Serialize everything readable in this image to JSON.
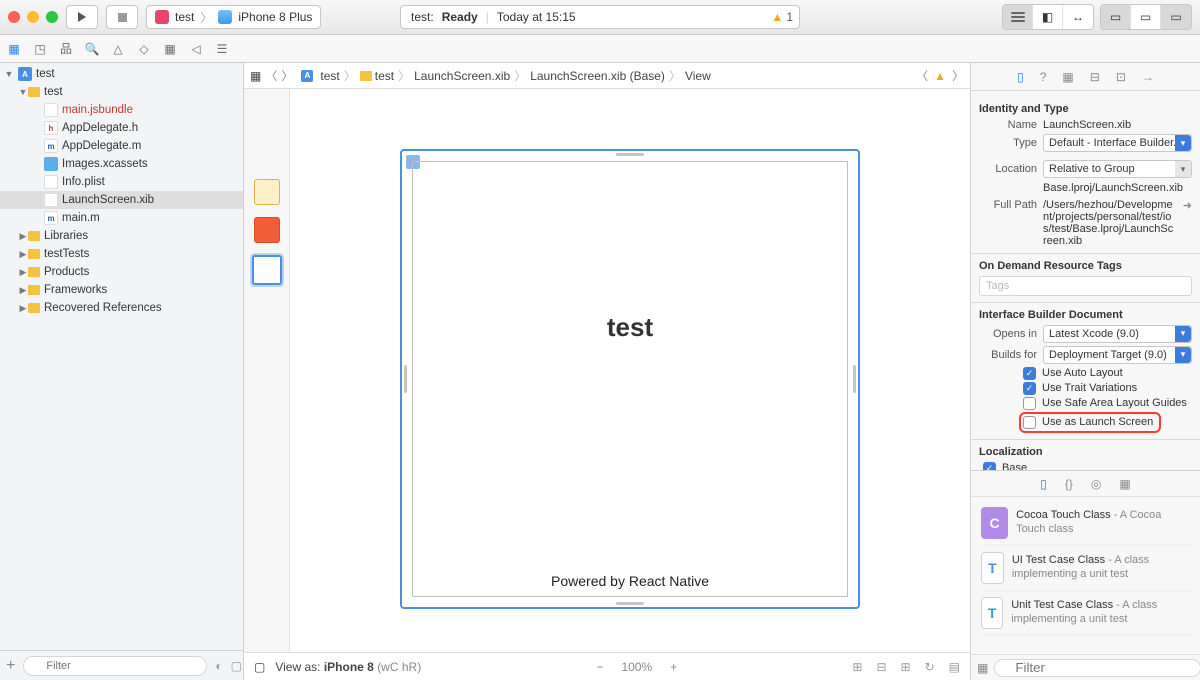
{
  "titlebar": {
    "scheme_target": "test",
    "scheme_device": "iPhone 8 Plus",
    "status_project": "test:",
    "status_state": "Ready",
    "status_time": "Today at 15:15",
    "warning_count": "1"
  },
  "navigator": {
    "root": "test",
    "group": "test",
    "files": {
      "main_jsbundle": "main.jsbundle",
      "appdelegate_h": "AppDelegate.h",
      "appdelegate_m": "AppDelegate.m",
      "images_xcassets": "Images.xcassets",
      "info_plist": "Info.plist",
      "launchscreen_xib": "LaunchScreen.xib",
      "main_m": "main.m"
    },
    "folders": {
      "libraries": "Libraries",
      "testTests": "testTests",
      "products": "Products",
      "frameworks": "Frameworks",
      "recovered": "Recovered References"
    },
    "filter_placeholder": "Filter",
    "add_label": "+"
  },
  "jumpbar": {
    "items": [
      "test",
      "test",
      "LaunchScreen.xib",
      "LaunchScreen.xib (Base)",
      "View"
    ]
  },
  "canvas": {
    "title": "test",
    "subtitle": "Powered by React Native",
    "view_as_prefix": "View as:",
    "view_as_device": "iPhone 8",
    "view_as_suffix": "(wC hR)",
    "zoom_level": "100%"
  },
  "inspector": {
    "section_identity": "Identity and Type",
    "name_label": "Name",
    "name_value": "LaunchScreen.xib",
    "type_label": "Type",
    "type_value": "Default - Interface Builder...",
    "location_label": "Location",
    "location_value": "Relative to Group",
    "location_path": "Base.lproj/LaunchScreen.xib",
    "fullpath_label": "Full Path",
    "fullpath_value": "/Users/hezhou/Development/projects/personal/test/ios/test/Base.lproj/LaunchScreen.xib",
    "section_ondemand": "On Demand Resource Tags",
    "tags_placeholder": "Tags",
    "section_ibdoc": "Interface Builder Document",
    "opensin_label": "Opens in",
    "opensin_value": "Latest Xcode (9.0)",
    "buildsfor_label": "Builds for",
    "buildsfor_value": "Deployment Target (9.0)",
    "chk_autolayout": "Use Auto Layout",
    "chk_trait": "Use Trait Variations",
    "chk_safearea": "Use Safe Area Layout Guides",
    "chk_launchscreen": "Use as Launch Screen",
    "section_localization": "Localization",
    "loc_base": "Base"
  },
  "library": {
    "items": [
      {
        "title": "Cocoa Touch Class",
        "desc": " - A Cocoa Touch class"
      },
      {
        "title": "UI Test Case Class",
        "desc": " - A class implementing a unit test"
      },
      {
        "title": "Unit Test Case Class",
        "desc": " - A class implementing a unit test"
      }
    ],
    "filter_placeholder": "Filter"
  }
}
